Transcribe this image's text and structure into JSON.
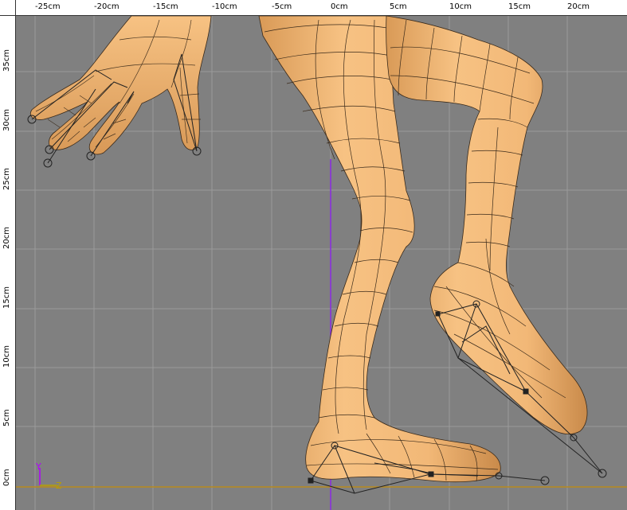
{
  "ruler": {
    "unit": "cm",
    "x_ticks": [
      "-25cm",
      "-20cm",
      "-15cm",
      "-10cm",
      "-5cm",
      "0cm",
      "5cm",
      "10cm",
      "15cm",
      "20cm"
    ],
    "y_ticks": [
      "35cm",
      "30cm",
      "25cm",
      "20cm",
      "15cm",
      "10cm",
      "5cm",
      "0cm"
    ]
  },
  "axis_indicator": {
    "up": "Y",
    "right": "Z"
  },
  "colors": {
    "background": "#808080",
    "grid": "#9a9a9a",
    "mesh_fill": "#f2b877",
    "mesh_shadow": "#c98a4a",
    "mesh_lines": "#3a2a1a",
    "ground_line": "#b88a1e",
    "center_line": "#8a2be2",
    "axis_y": "#b000ff",
    "axis_z": "#b8a000"
  },
  "scene": {
    "objects": [
      "hand",
      "left-leg",
      "right-leg",
      "left-foot",
      "right-foot",
      "bones"
    ]
  }
}
